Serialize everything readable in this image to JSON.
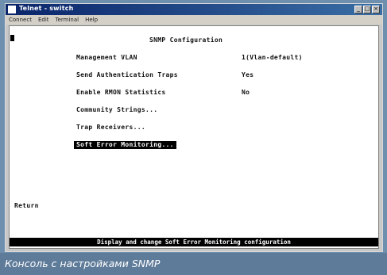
{
  "window": {
    "title": "Telnet - switch",
    "buttons": [
      "_",
      "□",
      "×"
    ]
  },
  "menu": [
    "Connect",
    "Edit",
    "Terminal",
    "Help"
  ],
  "screen": {
    "heading": "SNMP Configuration",
    "rows": [
      {
        "label": "Management VLAN",
        "value": "1(Vlan-default)"
      },
      {
        "label": "Send Authentication Traps",
        "value": "Yes"
      },
      {
        "label": "Enable RMON Statistics",
        "value": "No"
      }
    ],
    "links": [
      "Community Strings...",
      "Trap Receivers..."
    ],
    "selected_item": "Soft Error Monitoring...",
    "return_label": "Return",
    "status": "Display and change Soft Error Monitoring configuration"
  },
  "caption": "Консоль с настройками SNMP",
  "colors": {
    "caption_bg": "#5e7b9a",
    "status_bg": "#000000",
    "title_bg": "#0a246a"
  }
}
